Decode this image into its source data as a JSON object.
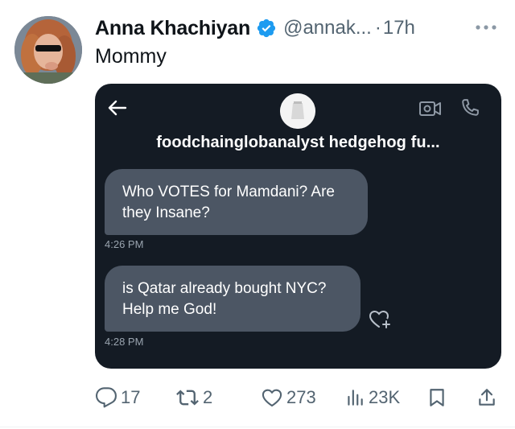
{
  "tweet": {
    "author_name": "Anna Khachiyan",
    "handle": "@annak...",
    "separator": "·",
    "time": "17h",
    "text": "Mommy",
    "colors": {
      "verified": "#1d9bf0",
      "text": "#0f1419",
      "muted": "#536471"
    }
  },
  "media": {
    "dm_name": "foodchainglobanalyst  hedgehog fu...",
    "messages": [
      {
        "lines": [
          "Who VOTES for Mamdani? Are",
          "they Insane?"
        ],
        "time": "4:26 PM"
      },
      {
        "lines": [
          "is Qatar already bought NYC?",
          "Help me  God!"
        ],
        "time": "4:28 PM"
      }
    ],
    "icons": [
      "back-arrow-icon",
      "video-call-icon",
      "phone-icon",
      "heart-add-icon"
    ],
    "colors": {
      "background": "#141b24",
      "bubble": "#4c5664",
      "timestamp": "#9aa4af"
    }
  },
  "actions": {
    "replies": "17",
    "reposts": "2",
    "likes": "273",
    "views": "23K"
  }
}
